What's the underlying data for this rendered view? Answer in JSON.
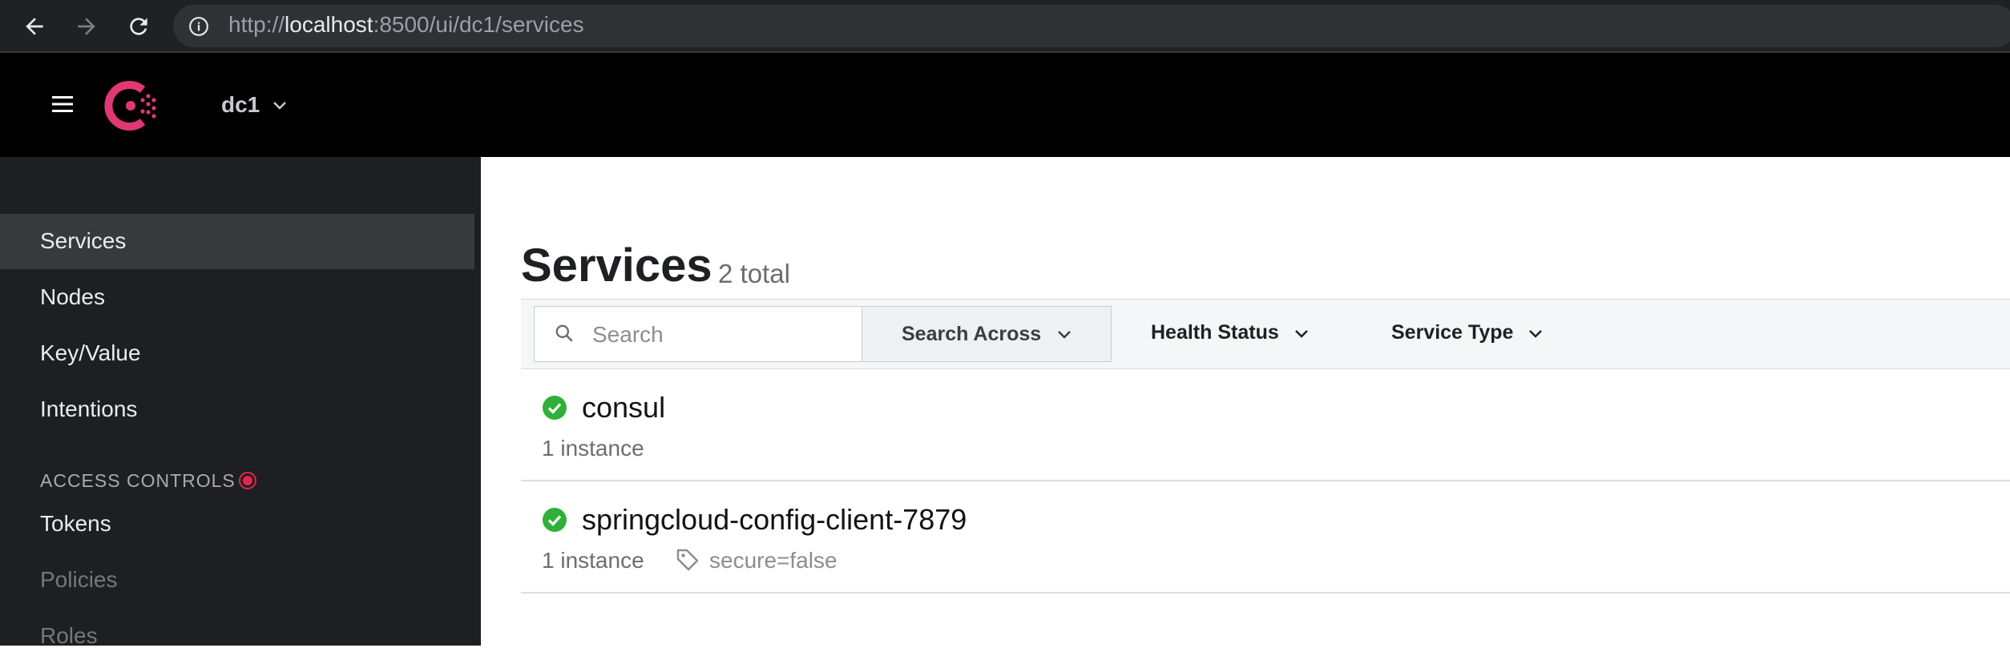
{
  "browser": {
    "url_prefix": "http://",
    "url_host": "localhost",
    "url_path": ":8500/ui/dc1/services"
  },
  "header": {
    "datacenter": "dc1"
  },
  "sidebar": {
    "items": [
      {
        "label": "Services"
      },
      {
        "label": "Nodes"
      },
      {
        "label": "Key/Value"
      },
      {
        "label": "Intentions"
      }
    ],
    "access_controls_title": "ACCESS CONTROLS",
    "access_items": [
      {
        "label": "Tokens"
      },
      {
        "label": "Policies"
      },
      {
        "label": "Roles"
      }
    ]
  },
  "main": {
    "title": "Services",
    "count": "2 total",
    "search_placeholder": "Search",
    "search_across_label": "Search Across",
    "health_status_label": "Health Status",
    "service_type_label": "Service Type",
    "services": [
      {
        "name": "consul",
        "instances": "1 instance",
        "tag": ""
      },
      {
        "name": "springcloud-config-client-7879",
        "instances": "1 instance",
        "tag": "secure=false"
      }
    ]
  },
  "colors": {
    "brand": "#e03875",
    "passing": "#2eb039",
    "alert": "#e0274a"
  }
}
